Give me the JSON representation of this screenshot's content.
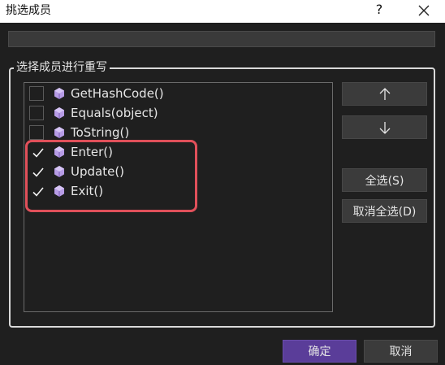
{
  "window": {
    "title": "挑选成员",
    "help_label": "?"
  },
  "group": {
    "label": "选择成员进行重写"
  },
  "members": [
    {
      "label": "GetHashCode()",
      "checked": false
    },
    {
      "label": "Equals(object)",
      "checked": false
    },
    {
      "label": "ToString()",
      "checked": false
    },
    {
      "label": "Enter()",
      "checked": true
    },
    {
      "label": "Update()",
      "checked": true
    },
    {
      "label": "Exit()",
      "checked": true
    }
  ],
  "buttons": {
    "move_up_icon": "arrow-up-icon",
    "move_down_icon": "arrow-down-icon",
    "select_all": "全选(S)",
    "deselect_all": "取消全选(D)",
    "ok": "确定",
    "cancel": "取消"
  },
  "colors": {
    "accent": "#5a3d99",
    "highlight": "#e0505a",
    "method_icon": "#b79ce6"
  }
}
